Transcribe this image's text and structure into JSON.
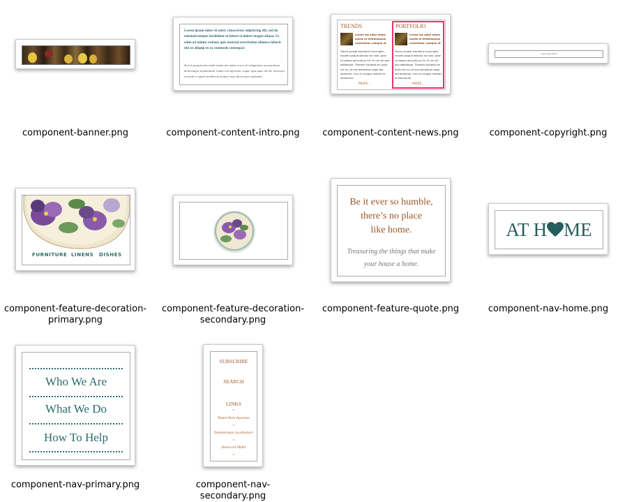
{
  "files": [
    {
      "filename": "component-banner.png"
    },
    {
      "filename": "component-content-intro.png"
    },
    {
      "filename": "component-content-news.png"
    },
    {
      "filename": "component-copyright.png"
    },
    {
      "filename_line1": "component-feature-decoration-",
      "filename_line2": "primary.png"
    },
    {
      "filename_line1": "component-feature-decoration-",
      "filename_line2": "secondary.png"
    },
    {
      "filename": "component-feature-quote.png"
    },
    {
      "filename": "component-nav-home.png"
    },
    {
      "filename": "component-nav-primary.png"
    },
    {
      "filename": "component-nav-secondary.png"
    }
  ],
  "intro": {
    "bold_text": "Lorem ipsum dolor sit amet, consectetur adipisicing elit, sed do eiusmod tempor incididunt ut labore et dolore magna aliqua. Ut enim ad minim veniam, quis nostrud exercitation ullamco laboris nisi ut aliquip ex ea commodo consequat.",
    "italic_text": "Sed ut perspiciatis unde omnis iste natus error sit voluptatem accusantium doloremque laudantium, totam rem aperiam, eaque ipsa quae ab illo inventore veritatis et quasi architecto beatae vitae dicta sunt explicabo."
  },
  "news": {
    "col1_title": "TRENDS",
    "col2_title": "PORTFOLIO",
    "bold_text": "Lorem ips adipi etiam mollis et elitletlalaum consetetur cumque ut",
    "body_text": "Treum scripte hendrerit incorrupte, movet congue alieutur ex nam, grae ce labore periculis ju hic. Eu sit ulli que oblitteque. Timeam volutpat sin quilo nei eu, at mei admodum oppo tae assentior. Cum in congue molesti ie atomorum.",
    "more_link": "MORE..."
  },
  "copyright": {
    "text": "Copyright 2010"
  },
  "decoration_primary": {
    "nav": [
      "FURNITURE",
      "LINENS",
      "DISHES"
    ]
  },
  "quote": {
    "line1": "Be it ever so humble,",
    "line2": "there’s no place",
    "line3": "like home.",
    "sub1": "Treasuring the things that make",
    "sub2": "your house a home."
  },
  "nav_home": {
    "before": "AT H",
    "after": "ME"
  },
  "nav_primary": [
    "Who We Are",
    "What We Do",
    "How To Help"
  ],
  "nav_secondary": {
    "subscribe": "SUBSCRIBE",
    "search": "SEARCH",
    "links": "LINKS",
    "link_items": [
      "Totam Rem Aperiam",
      "Doloremque Laudantum",
      "Deserunt Mollit"
    ],
    "separator": "~"
  },
  "colors": {
    "teal": "#275c5c",
    "brown": "#9a5a2a",
    "highlight": "#e8336b",
    "link": "#b06020"
  }
}
